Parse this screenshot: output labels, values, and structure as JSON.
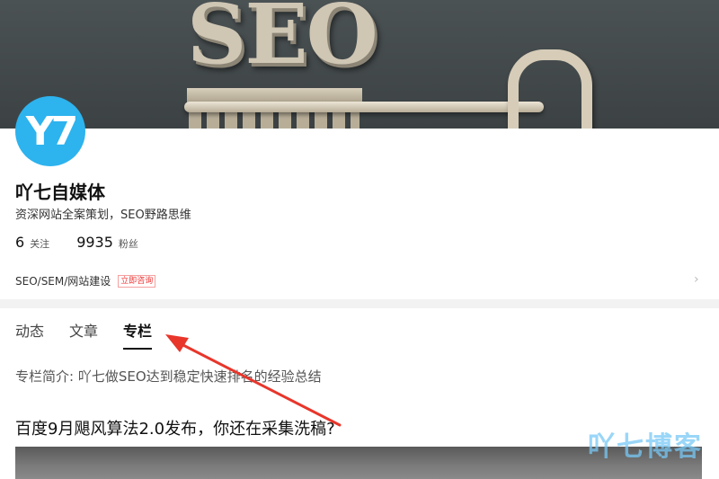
{
  "banner": {
    "text": "SEO"
  },
  "profile": {
    "avatar_text": "Y7",
    "name": "吖七自媒体",
    "bio": "资深网站全案策划，SEO野路思维",
    "following_count": "6",
    "following_label": "关注",
    "followers_count": "9935",
    "followers_label": "粉丝",
    "category": "SEO/SEM/网站建设",
    "consult_badge": "立即咨询"
  },
  "tabs": [
    {
      "label": "动态",
      "active": false
    },
    {
      "label": "文章",
      "active": false
    },
    {
      "label": "专栏",
      "active": true
    }
  ],
  "column": {
    "intro": "专栏简介: 吖七做SEO达到稳定快速排名的经验总结"
  },
  "article": {
    "title": "百度9月飓风算法2.0发布，你还在采集洗稿?"
  },
  "watermark": "吖七博客",
  "colors": {
    "avatar_bg": "#2db3ee",
    "arrow": "#e8362b",
    "badge": "#e33333"
  }
}
